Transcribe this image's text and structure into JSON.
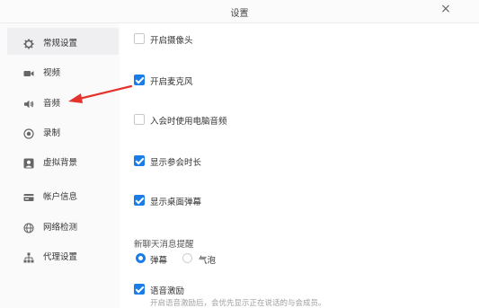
{
  "window": {
    "title": "设置",
    "close_glyph": "×"
  },
  "sidebar": {
    "items": [
      {
        "label": "常规设置",
        "icon": "gear-icon",
        "active": true
      },
      {
        "label": "视频",
        "icon": "video-camera-icon"
      },
      {
        "label": "音频",
        "icon": "speaker-icon"
      },
      {
        "label": "录制",
        "icon": "record-icon"
      },
      {
        "label": "虚拟背景",
        "icon": "virtual-background-icon"
      },
      {
        "label": "帐户信息",
        "icon": "account-card-icon"
      },
      {
        "label": "网络检测",
        "icon": "globe-icon"
      },
      {
        "label": "代理设置",
        "icon": "proxy-network-icon"
      }
    ]
  },
  "settings": {
    "options": [
      {
        "label": "开启摄像头",
        "checked": false
      },
      {
        "label": "开启麦克风",
        "checked": true
      },
      {
        "label": "入会时使用电脑音频",
        "checked": false
      },
      {
        "label": "显示参会时长",
        "checked": true
      },
      {
        "label": "显示桌面弹幕",
        "checked": true
      }
    ],
    "chat_notice": {
      "title": "新聊天消息提醒",
      "options": [
        {
          "label": "弹幕",
          "selected": true
        },
        {
          "label": "气泡",
          "selected": false
        }
      ]
    },
    "voice_activation": {
      "label": "语音激励",
      "checked": true,
      "hint": "开启语音激励后，会优先显示正在说话的与会成员。"
    }
  },
  "colors": {
    "accent": "#1a7ce6",
    "annotation_arrow": "#e5322d"
  }
}
